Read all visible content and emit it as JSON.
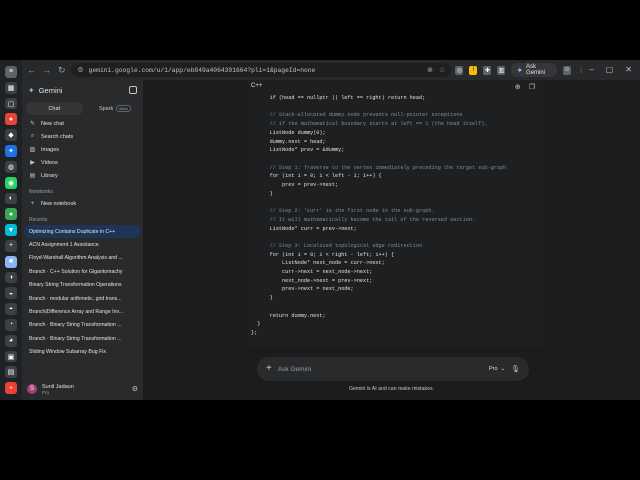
{
  "browser": {
    "url": "gemini.google.com/u/1/app/eb849a4064391664?pli=1&pageId=none",
    "ask_gemini_label": "Ask Gemini"
  },
  "sidebar": {
    "brand": "Gemini",
    "tabs": [
      {
        "label": "Chat"
      },
      {
        "label": "Spark",
        "badge": "Beta"
      }
    ],
    "items": [
      {
        "label": "New chat",
        "icon": "edit-icon"
      },
      {
        "label": "Search chats",
        "icon": "search-icon"
      },
      {
        "label": "Images",
        "icon": "image-icon"
      },
      {
        "label": "Videos",
        "icon": "video-icon"
      },
      {
        "label": "Library",
        "icon": "library-icon"
      }
    ],
    "notebooks_heading": "Notebooks",
    "new_notebook": "New notebook",
    "recents_heading": "Recents",
    "recents": [
      "Optimizing Contains Duplicate in C++",
      "ACN Assignment 1 Assistance",
      "Floyd-Warshall Algorithm Analysis and ...",
      "Branch · C++ Solution for Gigantomachy",
      "Binary String Transformation Operations",
      "Branch · modular arithmetic, grid trans...",
      "Branch|Difference Array and Range Inv...",
      "Branch · Binary String Transformation ...",
      "Branch · Binary String Transformation ...",
      "Sliding Window Subarray Bug Fix"
    ],
    "user": {
      "name": "Sunil Jadaun",
      "plan": "Pro",
      "initial": "S"
    }
  },
  "code": {
    "language": "C++",
    "lines": [
      "if (head == nullptr || left == right) return head;",
      "",
      "// Stack-allocated dummy node prevents null-pointer exceptions",
      "// if the mathematical boundary starts at left == 1 (the head itself).",
      "ListNode dummy(0);",
      "dummy.next = head;",
      "ListNode* prev = &dummy;",
      "",
      "// Step 1: Traverse to the vertex immediately preceding the target sub-graph",
      "for (int i = 0; i < left - 1; i++) {",
      "    prev = prev->next;",
      "}",
      "",
      "// Step 2: 'curr' is the first node in the sub-graph.",
      "// It will mathematically become the tail of the reversed section.",
      "ListNode* curr = prev->next;",
      "",
      "// Step 3: Localized topological edge redirection",
      "for (int i = 0; i < right - left; i++) {",
      "    ListNode* next_node = curr->next;",
      "    curr->next = next_node->next;",
      "    next_node->next = prev->next;",
      "    prev->next = next_node;",
      "}",
      "",
      "return dummy.next;",
      "}",
      "};"
    ]
  },
  "prompt": {
    "placeholder": "Ask Gemini",
    "model": "Pro"
  },
  "disclaimer": "Gemini is AI and can make mistakes."
}
